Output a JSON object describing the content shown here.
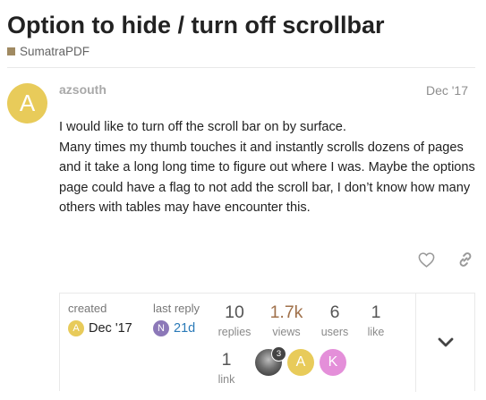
{
  "topic": {
    "title": "Option to hide / turn off scrollbar",
    "category": {
      "name": "SumatraPDF",
      "color": "#a08a62"
    }
  },
  "post": {
    "avatar_letter": "A",
    "avatar_color": "#e8cb5a",
    "username": "azsouth",
    "date": "Dec '17",
    "body": [
      "I would like to turn off the scroll bar on by surface.",
      "Many times my thumb touches it and instantly scrolls dozens of pages and it take a long long time to figure out where I was. Maybe the options page could have a flag to not add the scroll bar, I don’t know how many others with tables may have encounter this."
    ],
    "actions": [
      "heart-icon",
      "link-icon"
    ]
  },
  "summary": {
    "created": {
      "label": "created",
      "avatar_letter": "A",
      "avatar_color": "#e8cb5a",
      "value": "Dec '17"
    },
    "last_reply": {
      "label": "last reply",
      "avatar_letter": "N",
      "avatar_color": "#8c78b8",
      "value": "21d"
    },
    "stats": [
      {
        "num": "10",
        "label": "replies"
      },
      {
        "num": "1.7k",
        "label": "views"
      },
      {
        "num": "6",
        "label": "users"
      },
      {
        "num": "1",
        "label": "like"
      },
      {
        "num": "1",
        "label": "link"
      }
    ],
    "participants": [
      {
        "type": "photo",
        "badge": "3"
      },
      {
        "letter": "A",
        "color": "#e8cb5a"
      },
      {
        "letter": "K",
        "color": "#e48fd9"
      }
    ],
    "expand_icon": "chevron-down-icon"
  }
}
